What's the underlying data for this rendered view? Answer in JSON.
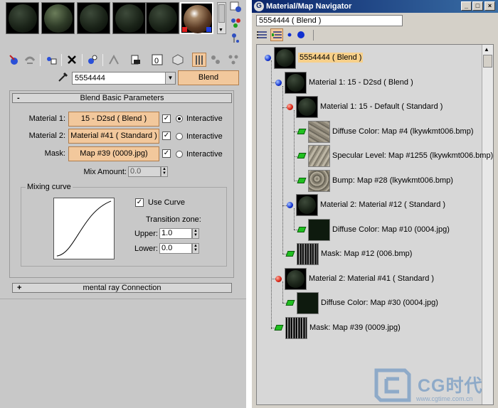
{
  "editor": {
    "slots": [
      {
        "name": "slot-1",
        "look": "dark"
      },
      {
        "name": "slot-2",
        "look": "rough"
      },
      {
        "name": "slot-3",
        "look": "dark"
      },
      {
        "name": "slot-4",
        "look": "dark"
      },
      {
        "name": "slot-5",
        "look": "dark"
      },
      {
        "name": "slot-6",
        "look": "shiny",
        "selected": true
      }
    ],
    "material_name": "5554444",
    "material_type": "Blend",
    "blend_rollout": {
      "title": "Blend Basic Parameters",
      "collapse_sign": "-",
      "material1_label": "Material 1:",
      "material1_value": "15 - D2sd  ( Blend )",
      "material2_label": "Material 2:",
      "material2_value": "Material #41  ( Standard )",
      "mask_label": "Mask:",
      "mask_value": "Map #39 (0009.jpg)",
      "interactive_label": "Interactive",
      "mix_amount_label": "Mix Amount:",
      "mix_amount_value": "0.0",
      "mixing_curve_label": "Mixing curve",
      "use_curve_label": "Use Curve",
      "transition_zone_label": "Transition zone:",
      "upper_label": "Upper:",
      "upper_value": "1.0",
      "lower_label": "Lower:",
      "lower_value": "0.0"
    },
    "mental_ray_rollout": {
      "title": "mental ray Connection",
      "expand_sign": "+"
    }
  },
  "navigator": {
    "title": "Material/Map Navigator",
    "name_field": "5554444  ( Blend )",
    "window_buttons": [
      "_",
      "□",
      "×"
    ],
    "tree": [
      {
        "label": "5554444  ( Blend )",
        "bullet": "blue",
        "thumb": "mat",
        "highlight": true
      },
      {
        "label": "Material 1: 15 - D2sd  ( Blend )",
        "bullet": "blue",
        "thumb": "mat"
      },
      {
        "label": "Material 1: 15 - Default  ( Standard )",
        "bullet": "red",
        "thumb": "mat"
      },
      {
        "label": "Diffuse Color: Map #4 (lkywkmt006.bmp)",
        "bullet": "map",
        "thumb": "tex1"
      },
      {
        "label": "Specular Level: Map #1255 (lkywkmt006.bmp)",
        "bullet": "map",
        "thumb": "tex2"
      },
      {
        "label": "Bump: Map #28 (lkywkmt006.bmp)",
        "bullet": "map",
        "thumb": "tex3"
      },
      {
        "label": "Material 2: Material #12  ( Standard )",
        "bullet": "blue",
        "thumb": "mat"
      },
      {
        "label": "Diffuse Color: Map #10 (0004.jpg)",
        "bullet": "map",
        "thumb": "dark"
      },
      {
        "label": "Mask: Map #12 (006.bmp)",
        "bullet": "map",
        "thumb": "streak"
      },
      {
        "label": "Material 2: Material #41  ( Standard )",
        "bullet": "red",
        "thumb": "mat"
      },
      {
        "label": "Diffuse Color: Map #30 (0004.jpg)",
        "bullet": "map",
        "thumb": "dark"
      },
      {
        "label": "Mask: Map #39 (0009.jpg)",
        "bullet": "map",
        "thumb": "streak"
      }
    ]
  },
  "watermark": {
    "brand": "CG时代",
    "url": "www.cgtime.com.cn"
  },
  "colors": {
    "map_button": "#f2c89c",
    "title_bar": "#0a246a",
    "highlight": "#f7d08a"
  }
}
